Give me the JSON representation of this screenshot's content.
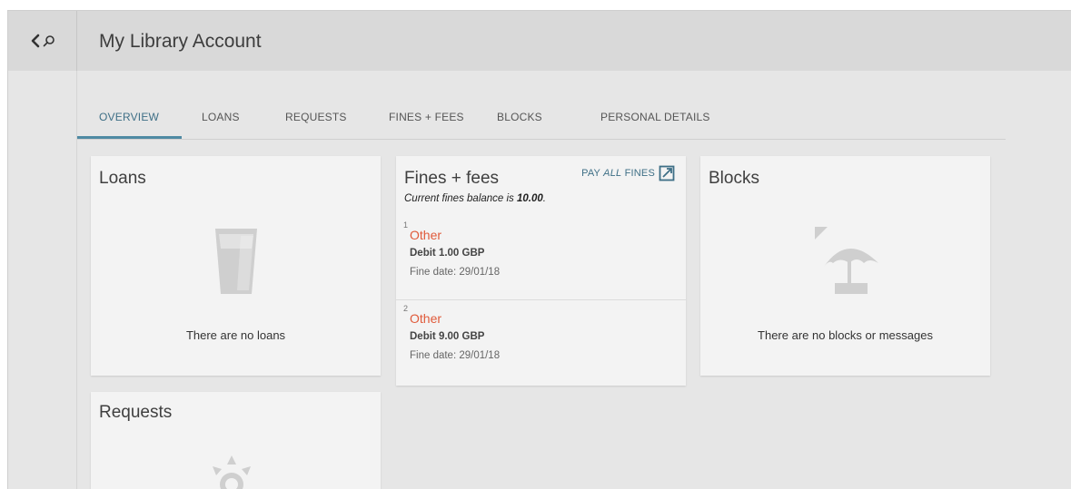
{
  "header": {
    "title": "My Library Account"
  },
  "tabs": [
    {
      "label": "OVERVIEW"
    },
    {
      "label": "LOANS"
    },
    {
      "label": "REQUESTS"
    },
    {
      "label": "FINES + FEES"
    },
    {
      "label": "BLOCKS"
    },
    {
      "label": "PERSONAL DETAILS"
    }
  ],
  "active_tab": "OVERVIEW",
  "loans_card": {
    "title": "Loans",
    "empty_text": "There are no loans",
    "icon": "glass-icon"
  },
  "fines_card": {
    "title": "Fines + fees",
    "pay_prefix": "PAY ",
    "pay_emphasis": "ALL",
    "pay_suffix": " FINES",
    "balance_prefix": "Current fines balance is ",
    "balance_value": "10.00",
    "balance_suffix": ".",
    "items": [
      {
        "num": "1",
        "type": "Other",
        "debit": "Debit 1.00 GBP",
        "date": "Fine date: 29/01/18"
      },
      {
        "num": "2",
        "type": "Other",
        "debit": "Debit 9.00 GBP",
        "date": "Fine date: 29/01/18"
      }
    ]
  },
  "blocks_card": {
    "title": "Blocks",
    "empty_text": "There are no blocks or messages",
    "icon": "beach-umbrella-icon"
  },
  "requests_card": {
    "title": "Requests",
    "icon": "sun-icon"
  },
  "colors": {
    "accent": "#3e6f86",
    "fine_type": "#e05a3a",
    "icon_grey": "#cfcfcf"
  }
}
